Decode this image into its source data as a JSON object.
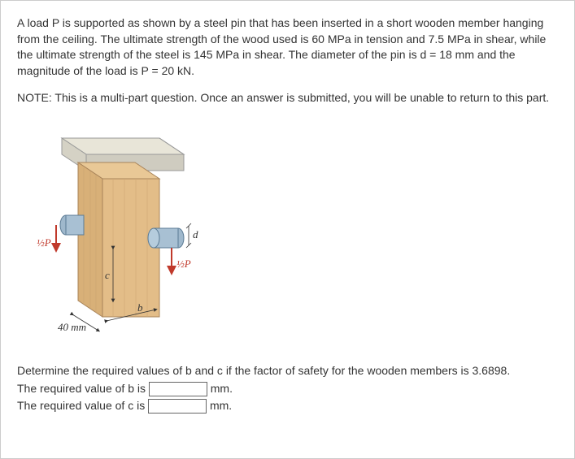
{
  "problem": {
    "paragraph1": "A load P is supported as shown by a steel pin that has been inserted in a short wooden member hanging from the ceiling. The ultimate strength of the wood used is 60 MPa in tension and 7.5 MPa in shear, while the ultimate strength of the steel is 145 MPa in shear. The diameter of the pin is d = 18 mm and the magnitude of the load is P = 20 kN.",
    "note": "NOTE: This is a multi-part question. Once an answer is submitted, you will be unable to return to this part."
  },
  "diagram": {
    "width_label": "40 mm",
    "dim_b": "b",
    "dim_c": "c",
    "dim_d": "d",
    "load_left": "½P",
    "load_right": "½P"
  },
  "question": {
    "prompt": "Determine the required values of b and c if the factor of safety for the wooden members is 3.6898.",
    "line_b_pre": "The required value of b is ",
    "line_b_post": " mm.",
    "line_c_pre": "The required value of c is ",
    "line_c_post": " mm."
  }
}
